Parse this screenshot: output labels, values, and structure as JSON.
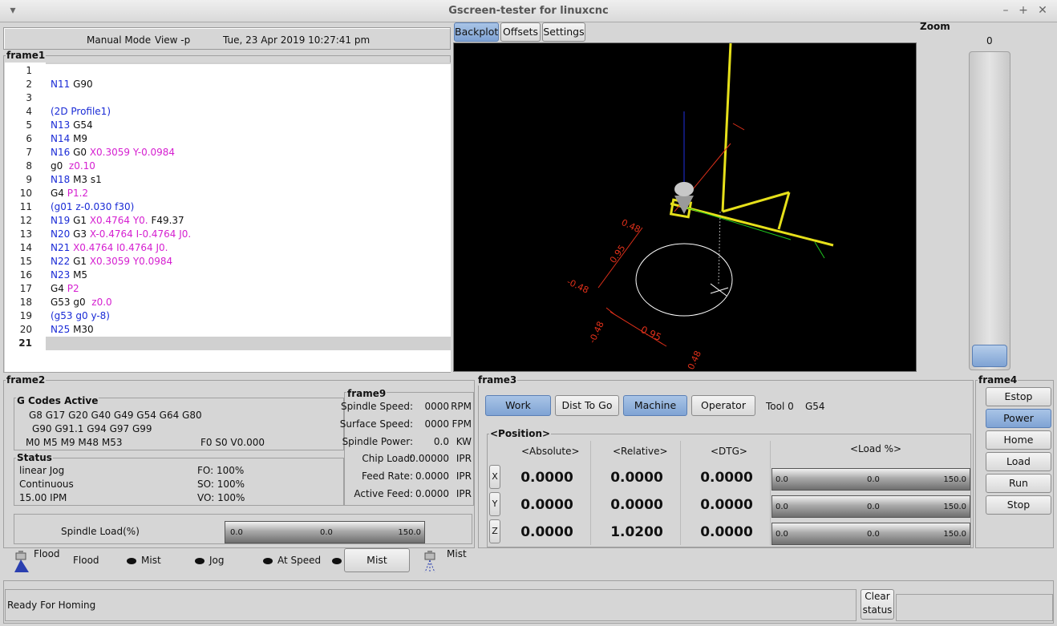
{
  "window": {
    "title": "Gscreen-tester for linuxcnc"
  },
  "header": {
    "mode": "Manual Mode",
    "view": "View -p",
    "datetime": "Tue, 23 Apr 2019  10:27:41 pm"
  },
  "frame1": {
    "label": "frame1",
    "lines": [
      {
        "n": "1",
        "parts": []
      },
      {
        "n": "2",
        "parts": [
          {
            "t": "N11",
            "c": "kw"
          },
          {
            "t": " G90",
            "c": ""
          }
        ]
      },
      {
        "n": "3",
        "parts": []
      },
      {
        "n": "4",
        "parts": [
          {
            "t": "(2D Profile1)",
            "c": "cm"
          }
        ]
      },
      {
        "n": "5",
        "parts": [
          {
            "t": "N13",
            "c": "kw"
          },
          {
            "t": " G54",
            "c": ""
          }
        ]
      },
      {
        "n": "6",
        "parts": [
          {
            "t": "N14",
            "c": "kw"
          },
          {
            "t": " M9",
            "c": ""
          }
        ]
      },
      {
        "n": "7",
        "parts": [
          {
            "t": "N16",
            "c": "kw"
          },
          {
            "t": " G0 ",
            "c": ""
          },
          {
            "t": "X0.3059 Y-0.0984",
            "c": "pm"
          }
        ]
      },
      {
        "n": "8",
        "parts": [
          {
            "t": "g0  ",
            "c": ""
          },
          {
            "t": "z0.10",
            "c": "pm"
          }
        ]
      },
      {
        "n": "9",
        "parts": [
          {
            "t": "N18",
            "c": "kw"
          },
          {
            "t": " M3 s1",
            "c": ""
          }
        ]
      },
      {
        "n": "10",
        "parts": [
          {
            "t": "G4 ",
            "c": ""
          },
          {
            "t": "P1.2",
            "c": "pm"
          }
        ]
      },
      {
        "n": "11",
        "parts": [
          {
            "t": "(g01 z-0.030 f30)",
            "c": "cm"
          }
        ]
      },
      {
        "n": "12",
        "parts": [
          {
            "t": "N19",
            "c": "kw"
          },
          {
            "t": " G1 ",
            "c": ""
          },
          {
            "t": "X0.4764 Y0.",
            "c": "pm"
          },
          {
            "t": " F49.37",
            "c": ""
          }
        ]
      },
      {
        "n": "13",
        "parts": [
          {
            "t": "N20",
            "c": "kw"
          },
          {
            "t": " G3 ",
            "c": ""
          },
          {
            "t": "X-0.4764 I-0.4764 J0.",
            "c": "pm"
          }
        ]
      },
      {
        "n": "14",
        "parts": [
          {
            "t": "N21",
            "c": "kw"
          },
          {
            "t": " ",
            "c": ""
          },
          {
            "t": "X0.4764 I0.4764 J0.",
            "c": "pm"
          }
        ]
      },
      {
        "n": "15",
        "parts": [
          {
            "t": "N22",
            "c": "kw"
          },
          {
            "t": " G1 ",
            "c": ""
          },
          {
            "t": "X0.3059 Y0.0984",
            "c": "pm"
          }
        ]
      },
      {
        "n": "16",
        "parts": [
          {
            "t": "N23",
            "c": "kw"
          },
          {
            "t": " M5",
            "c": ""
          }
        ]
      },
      {
        "n": "17",
        "parts": [
          {
            "t": "G4 ",
            "c": ""
          },
          {
            "t": "P2",
            "c": "pm"
          }
        ]
      },
      {
        "n": "18",
        "parts": [
          {
            "t": "G53 g0  ",
            "c": ""
          },
          {
            "t": "z0.0",
            "c": "pm"
          }
        ]
      },
      {
        "n": "19",
        "parts": [
          {
            "t": "(g53 g0 y-8)",
            "c": "cm"
          }
        ]
      },
      {
        "n": "20",
        "parts": [
          {
            "t": "N25",
            "c": "kw"
          },
          {
            "t": " M30",
            "c": ""
          }
        ]
      },
      {
        "n": "21",
        "parts": []
      }
    ]
  },
  "tabs": [
    {
      "label": "Backplot",
      "active": true
    },
    {
      "label": "Offsets",
      "active": false
    },
    {
      "label": "Settings",
      "active": false
    }
  ],
  "backplot": {
    "labels": [
      "0.48",
      "0.95",
      "-0.48",
      "-0.48",
      "0.95",
      "0.48"
    ]
  },
  "zoom": {
    "label": "Zoom",
    "value": "0"
  },
  "frame2": {
    "label": "frame2",
    "gcodes_title": "G Codes Active",
    "gcodes_line1": "G8 G17 G20 G40 G49 G54 G64 G80",
    "gcodes_line2": "G90 G91.1 G94 G97 G99",
    "mcodes": "M0 M5 M9 M48 M53",
    "fsv": "F0   S0   V0.000",
    "status_title": "Status",
    "status_rows": [
      {
        "left": "linear Jog",
        "right": "FO: 100%"
      },
      {
        "left": "Continuous",
        "right": "SO: 100%"
      },
      {
        "left": "15.00 IPM",
        "right": "VO: 100%"
      }
    ],
    "spindle_load_label": "Spindle Load(%)",
    "spindle_load_bar": {
      "min": "0.0",
      "mid": "0.0",
      "max": "150.0"
    }
  },
  "frame9": {
    "label": "frame9",
    "rows": [
      {
        "label": "Spindle Speed:",
        "value": "0000",
        "unit": "RPM"
      },
      {
        "label": "Surface Speed:",
        "value": "0000",
        "unit": "FPM"
      },
      {
        "label": "Spindle Power:",
        "value": "0.0",
        "unit": "KW"
      },
      {
        "label": "Chip Load:",
        "value": "0.00000",
        "unit": "IPR"
      },
      {
        "label": "Feed Rate:",
        "value": "0.0000",
        "unit": "IPR"
      },
      {
        "label": "Active Feed:",
        "value": "0.0000",
        "unit": "IPR"
      }
    ]
  },
  "frame3": {
    "label": "frame3",
    "buttons": [
      {
        "label": "Work",
        "active": true
      },
      {
        "label": "Dist To Go",
        "active": false
      },
      {
        "label": "Machine",
        "active": true
      },
      {
        "label": "Operator",
        "active": false
      }
    ],
    "tool": "Tool 0",
    "offset": "G54",
    "position_label": "<Position>",
    "headers": [
      "<Absolute>",
      "<Relative>",
      "<DTG>",
      "<Load %>"
    ],
    "axes": [
      {
        "axis": "X",
        "abs": "0.0000",
        "rel": "0.0000",
        "dtg": "0.0000",
        "load": {
          "min": "0.0",
          "mid": "0.0",
          "max": "150.0"
        }
      },
      {
        "axis": "Y",
        "abs": "0.0000",
        "rel": "0.0000",
        "dtg": "0.0000",
        "load": {
          "min": "0.0",
          "mid": "0.0",
          "max": "150.0"
        }
      },
      {
        "axis": "Z",
        "abs": "0.0000",
        "rel": "1.0200",
        "dtg": "0.0000",
        "load": {
          "min": "0.0",
          "mid": "0.0",
          "max": "150.0"
        }
      }
    ]
  },
  "frame4": {
    "label": "frame4",
    "buttons": [
      {
        "label": "Estop",
        "active": false
      },
      {
        "label": "Power",
        "active": true
      },
      {
        "label": "Home",
        "active": false
      },
      {
        "label": "Load",
        "active": false
      },
      {
        "label": "Run",
        "active": false
      },
      {
        "label": "Stop",
        "active": false
      }
    ]
  },
  "indicators": {
    "flood_icon_label": "Flood",
    "flood": "Flood",
    "mist": "Mist",
    "jog": "Jog",
    "at_speed": "At Speed",
    "mist_button": "Mist",
    "mist_icon_label": "Mist"
  },
  "statusbar": {
    "message": "Ready For Homing",
    "clear": "Clear\nstatus"
  }
}
